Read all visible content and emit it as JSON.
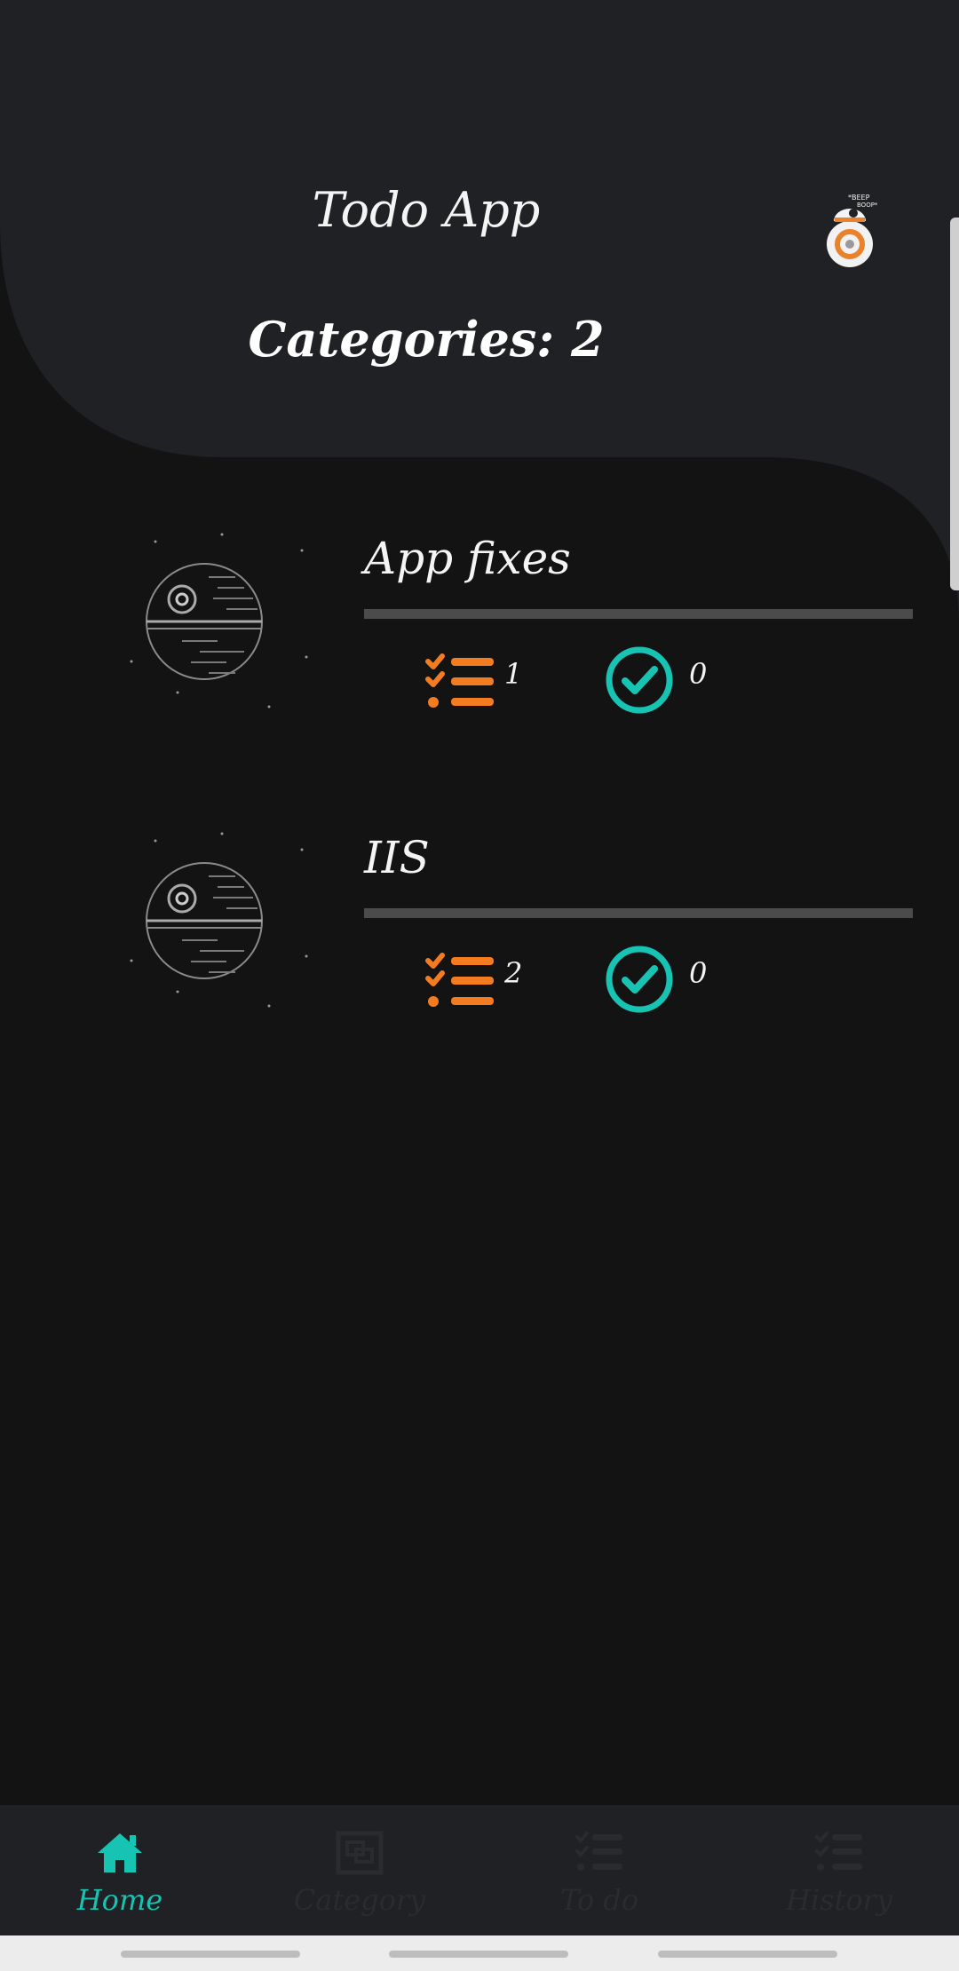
{
  "header": {
    "title": "Todo App",
    "categories_label": "Categories: 2",
    "avatar_icon": "bb8-droid-avatar"
  },
  "categories": [
    {
      "name": "App fixes",
      "todo_count": "1",
      "done_count": "0",
      "icon": "death-star-icon"
    },
    {
      "name": "IIS",
      "todo_count": "2",
      "done_count": "0",
      "icon": "death-star-icon"
    }
  ],
  "nav": {
    "items": [
      {
        "label": "Home",
        "icon": "home-icon",
        "active": true
      },
      {
        "label": "Category",
        "icon": "category-icon",
        "active": false
      },
      {
        "label": "To do",
        "icon": "checklist-icon",
        "active": false
      },
      {
        "label": "History",
        "icon": "checklist-icon",
        "active": false
      }
    ]
  },
  "colors": {
    "accent": "#17c3b2",
    "orange": "#f47c20",
    "background": "#131314",
    "header": "#202124"
  }
}
